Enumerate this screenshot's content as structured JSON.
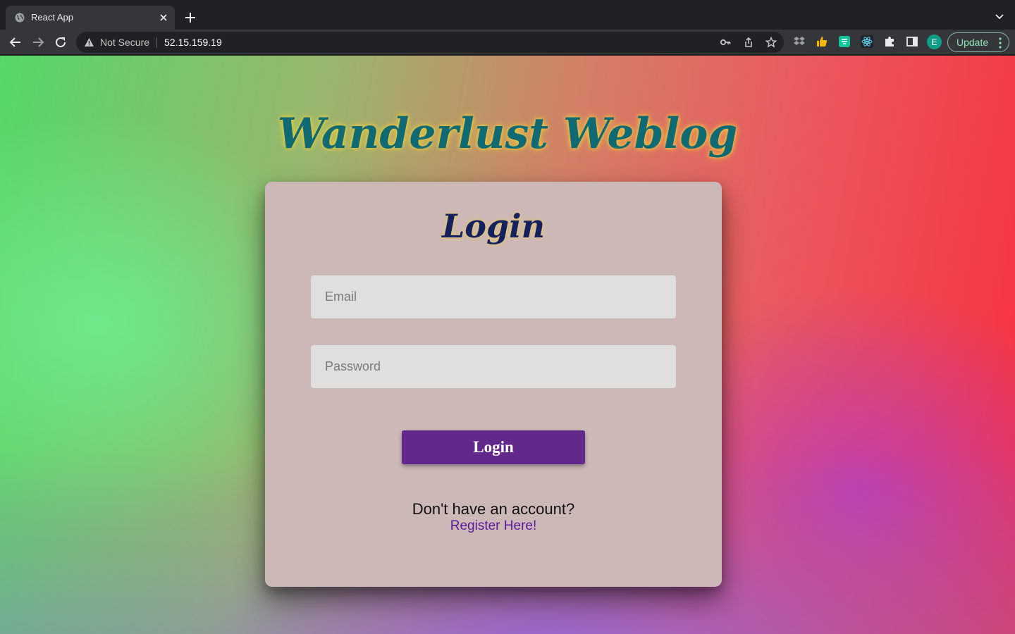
{
  "browser": {
    "tab_title": "React App",
    "security_label": "Not Secure",
    "url": "52.15.159.19",
    "profile_initial": "E",
    "update_label": "Update"
  },
  "page": {
    "site_title": "Wanderlust Weblog",
    "form_title": "Login",
    "email_placeholder": "Email",
    "password_placeholder": "Password",
    "login_button": "Login",
    "no_account_text": "Don't have an account?",
    "register_link": "Register Here!"
  },
  "colors": {
    "card_background": "#cdb8b8",
    "button_background": "#63288c",
    "title_color": "#0f6a73",
    "form_title_color": "#14215e",
    "link_color": "#5b1a9a"
  },
  "icons": [
    "globe-icon",
    "close-icon",
    "plus-icon",
    "chevron-down-icon",
    "back-icon",
    "forward-icon",
    "reload-icon",
    "warning-icon",
    "key-icon",
    "share-icon",
    "star-icon",
    "dropbox-icon",
    "thumbs-up-icon",
    "grammarly-icon",
    "react-devtools-icon",
    "puzzle-icon",
    "side-panel-icon",
    "menu-dots-icon"
  ]
}
